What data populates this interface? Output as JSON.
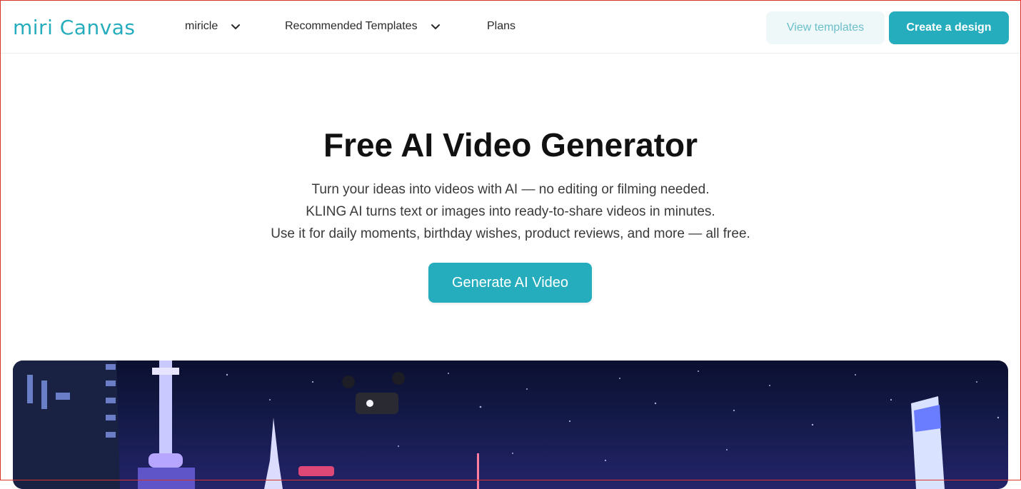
{
  "brand": {
    "name": "miri Canvas",
    "color": "#26adbd"
  },
  "nav": {
    "items": [
      {
        "label": "miricle",
        "has_dropdown": true
      },
      {
        "label": "Recommended Templates",
        "has_dropdown": true
      },
      {
        "label": "Plans",
        "has_dropdown": false
      }
    ]
  },
  "header_actions": {
    "view_templates": "View templates",
    "create_design": "Create a design"
  },
  "hero": {
    "title": "Free AI Video Generator",
    "lines": [
      "Turn your ideas into videos with AI — no editing or filming needed.",
      "KLING AI turns text or images into ready-to-share videos in minutes.",
      "Use it for daily moments, birthday wishes, product reviews, and more — all free."
    ],
    "cta": "Generate AI Video"
  },
  "preview": {
    "icon": "night-city-video-preview"
  }
}
